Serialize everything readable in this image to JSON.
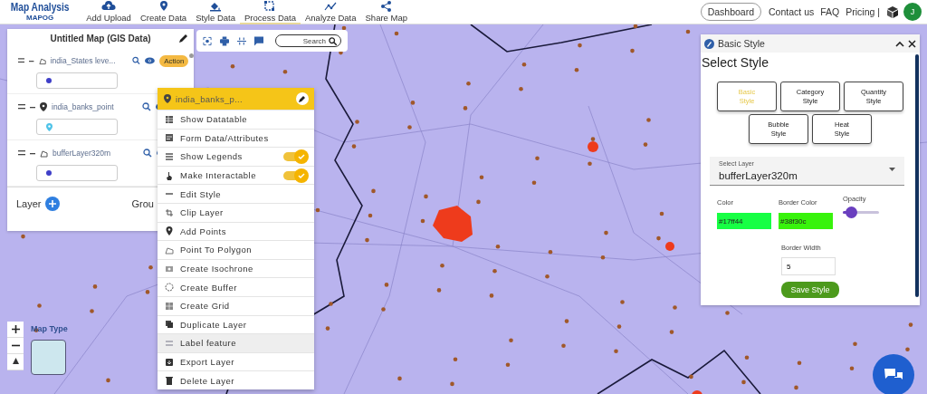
{
  "header": {
    "logo": {
      "title": "Map Analysis",
      "subtitle": "MAPOG"
    },
    "nav": [
      {
        "label": "Add Upload",
        "selected": false
      },
      {
        "label": "Create Data",
        "selected": false
      },
      {
        "label": "Style Data",
        "selected": false
      },
      {
        "label": "Process Data",
        "selected": true
      },
      {
        "label": "Analyze Data",
        "selected": false
      },
      {
        "label": "Share Map",
        "selected": false
      }
    ],
    "dashboard": "Dashboard",
    "links": [
      "Contact us",
      "FAQ",
      "Pricing |"
    ],
    "avatar": "J"
  },
  "layers_panel": {
    "title": "Untitled Map (GIS Data)",
    "action": "Action",
    "layers": [
      {
        "name": "india_States leve...",
        "kind": "polygon",
        "color": "#3f3fc8"
      },
      {
        "name": "india_banks_point",
        "kind": "point",
        "color": "#4fc3e8"
      },
      {
        "name": "bufferLayer320m",
        "kind": "polygon",
        "color": "#3f3fc8"
      }
    ],
    "footer_layer": "Layer",
    "footer_group": "Grou"
  },
  "map_toolbar": {
    "search_placeholder": "Search"
  },
  "context_menu": {
    "title": "india_banks_p...",
    "items": [
      {
        "label": "Show Datatable",
        "kind": "action",
        "highlighted": false
      },
      {
        "label": "Form Data/Attributes",
        "kind": "action",
        "highlighted": false
      },
      {
        "label": "Show Legends",
        "kind": "toggle",
        "on": true,
        "highlighted": false
      },
      {
        "label": "Make Interactable",
        "kind": "toggle",
        "on": true,
        "highlighted": false
      },
      {
        "label": "Edit Style",
        "kind": "action",
        "highlighted": false
      },
      {
        "label": "Clip Layer",
        "kind": "action",
        "highlighted": false
      },
      {
        "label": "Add Points",
        "kind": "action",
        "highlighted": false
      },
      {
        "label": "Point To Polygon",
        "kind": "action",
        "highlighted": false
      },
      {
        "label": "Create Isochrone",
        "kind": "action",
        "highlighted": false
      },
      {
        "label": "Create Buffer",
        "kind": "action",
        "highlighted": false
      },
      {
        "label": "Create Grid",
        "kind": "action",
        "highlighted": false
      },
      {
        "label": "Duplicate Layer",
        "kind": "action",
        "highlighted": false
      },
      {
        "label": "Label feature",
        "kind": "action",
        "highlighted": true
      },
      {
        "label": "Export Layer",
        "kind": "action",
        "highlighted": false
      },
      {
        "label": "Delete Layer",
        "kind": "action",
        "highlighted": false
      }
    ]
  },
  "style_panel": {
    "title": "Basic Style",
    "heading": "Select Style",
    "style_types": [
      {
        "label": "Basic\nStyle",
        "selected": true
      },
      {
        "label": "Category\nStyle",
        "selected": false
      },
      {
        "label": "Quantity\nStyle",
        "selected": false
      },
      {
        "label": "Bubble\nStyle",
        "selected": false
      },
      {
        "label": "Heat\nStyle",
        "selected": false
      }
    ],
    "select_layer": {
      "label": "Select Layer",
      "value": "bufferLayer320m"
    },
    "color": {
      "label": "Color",
      "value": "#17ff44",
      "color": "#17ff44"
    },
    "border_color": {
      "label": "Border Color",
      "value": "#38f30c",
      "color": "#38f30c"
    },
    "opacity": {
      "label": "Opacity",
      "level": 0.12
    },
    "border_width": {
      "label": "Border Width",
      "value": "5"
    },
    "save": "Save Style"
  },
  "map_type": {
    "label": "Map Type"
  }
}
